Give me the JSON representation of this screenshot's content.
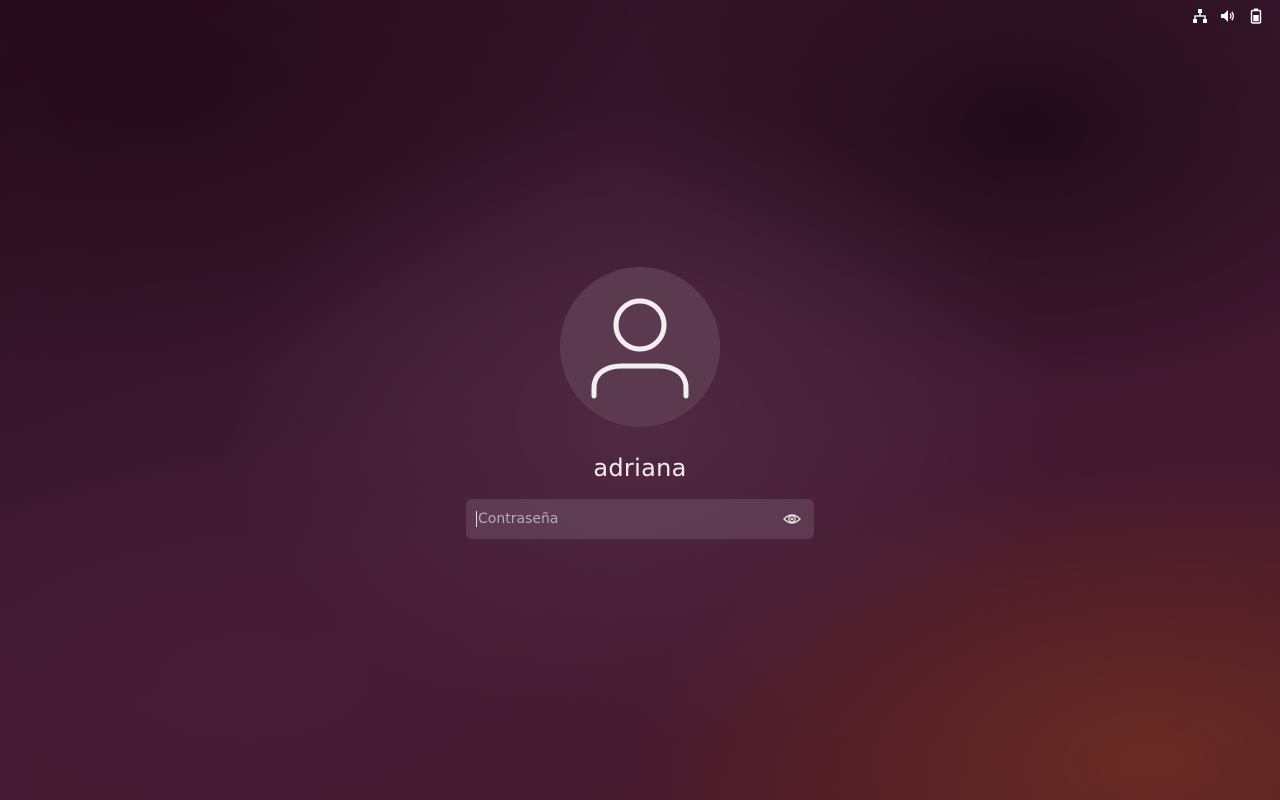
{
  "top_bar": {
    "icons": [
      "network-wired-icon",
      "volume-icon",
      "battery-icon"
    ]
  },
  "login": {
    "username": "adriana",
    "avatar_icon": "user-avatar-icon",
    "password_field": {
      "placeholder": "Contraseña",
      "value": "",
      "reveal_icon": "eye-icon"
    }
  },
  "colors": {
    "background": "#3a1628",
    "avatar_bg": "#5b3a4f",
    "text": "#f2ecef"
  }
}
